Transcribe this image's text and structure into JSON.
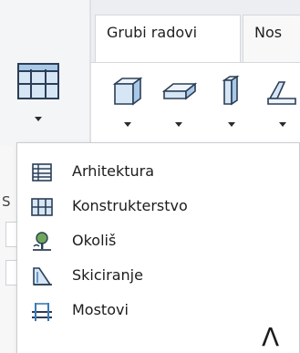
{
  "ribbon": {
    "tabs": [
      {
        "label": "Grubi radovi"
      },
      {
        "label": "Nos"
      }
    ],
    "big_button": {
      "icon": "module-building-icon"
    },
    "tools": [
      {
        "icon": "wall-icon"
      },
      {
        "icon": "slab-icon"
      },
      {
        "icon": "column-icon"
      },
      {
        "icon": "roof-icon"
      }
    ]
  },
  "background": {
    "left_pane_label": "S"
  },
  "menu": {
    "items": [
      {
        "label": "Arhitektura",
        "icon": "architecture-icon"
      },
      {
        "label": "Konstrukterstvo",
        "icon": "structure-icon"
      },
      {
        "label": "Okoliš",
        "icon": "landscape-icon"
      },
      {
        "label": "Skiciranje",
        "icon": "sketching-icon"
      },
      {
        "label": "Mostovi",
        "icon": "bridge-icon"
      }
    ],
    "collapse_glyph": "Λ"
  },
  "colors": {
    "icon_blue": "#3b79b8",
    "icon_light": "#a9c8e8",
    "icon_dark": "#2c3e57",
    "border": "#c9ccd1"
  }
}
